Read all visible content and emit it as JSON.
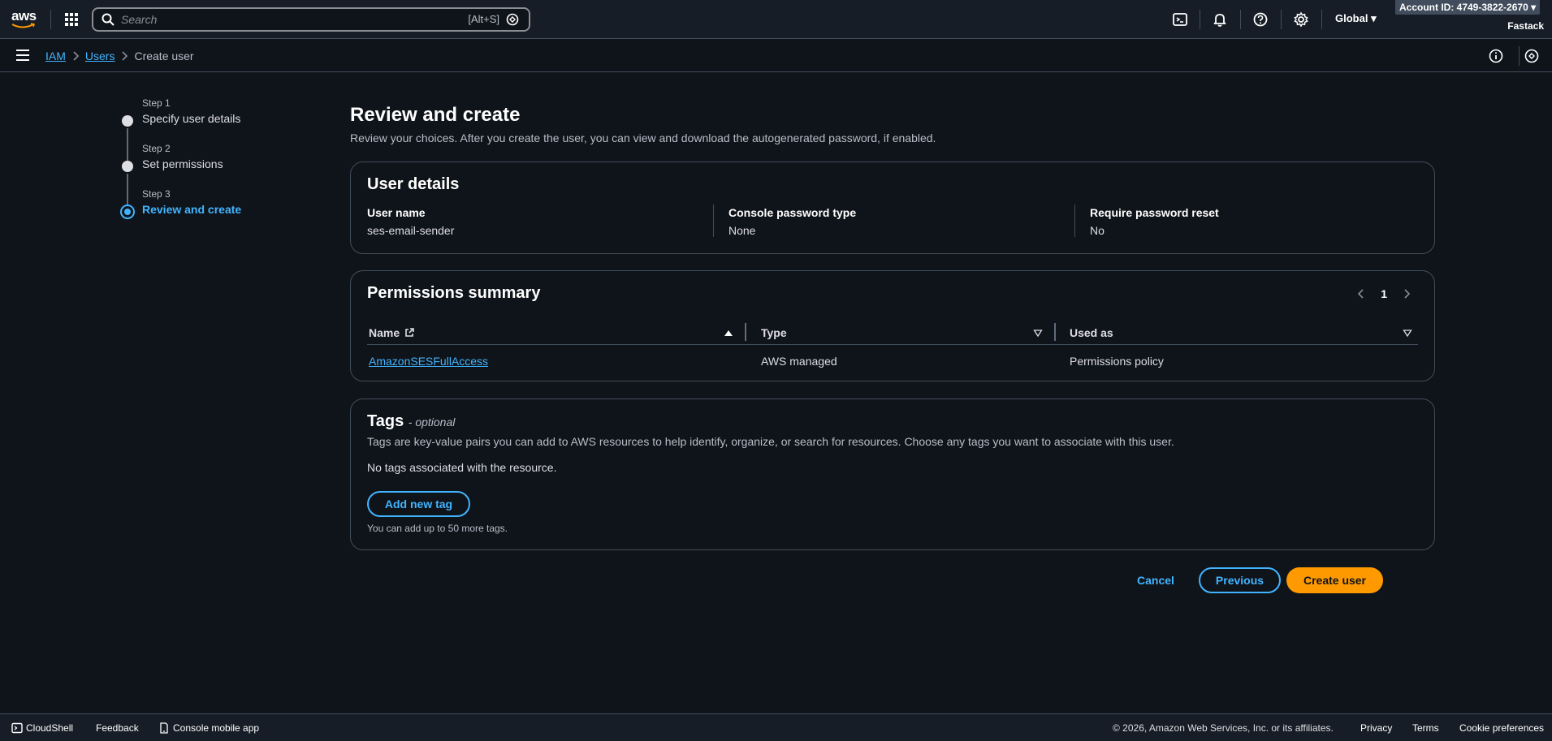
{
  "nav": {
    "logo": "aws",
    "search_placeholder": "Search",
    "search_shortcut": "[Alt+S]",
    "region": "Global",
    "account": "Account ID: 4749-3822-2670",
    "user": "Fastack",
    "icons": [
      "services-grid-icon",
      "cloudshell-icon",
      "bell-icon",
      "help-icon",
      "settings-icon"
    ]
  },
  "breadcrumb": {
    "items": [
      "IAM",
      "Users"
    ],
    "current": "Create user"
  },
  "stepper": {
    "steps": [
      {
        "label": "Step 1",
        "title": "Specify user details"
      },
      {
        "label": "Step 2",
        "title": "Set permissions"
      },
      {
        "label": "Step 3",
        "title": "Review and create"
      }
    ]
  },
  "page": {
    "title": "Review and create",
    "description": "Review your choices. After you create the user, you can view and download the autogenerated password, if enabled."
  },
  "user_details": {
    "title": "User details",
    "fields": [
      {
        "label": "User name",
        "value": "ses-email-sender"
      },
      {
        "label": "Console password type",
        "value": "None"
      },
      {
        "label": "Require password reset",
        "value": "No"
      }
    ]
  },
  "permissions": {
    "title": "Permissions summary",
    "page": "1",
    "columns": [
      "Name",
      "Type",
      "Used as"
    ],
    "rows": [
      {
        "name": "AmazonSESFullAccess",
        "type": "AWS managed",
        "used_as": "Permissions policy"
      }
    ]
  },
  "tags": {
    "title": "Tags",
    "optional": "- optional",
    "description": "Tags are key-value pairs you can add to AWS resources to help identify, organize, or search for resources. Choose any tags you want to associate with this user.",
    "empty": "No tags associated with the resource.",
    "add_button": "Add new tag",
    "hint": "You can add up to 50 more tags."
  },
  "actions": {
    "cancel": "Cancel",
    "previous": "Previous",
    "create": "Create user"
  },
  "footer": {
    "cloudshell": "CloudShell",
    "feedback": "Feedback",
    "mobile": "Console mobile app",
    "copyright": "© 2026, Amazon Web Services, Inc. or its affiliates.",
    "privacy": "Privacy",
    "terms": "Terms",
    "cookies": "Cookie preferences"
  },
  "colors": {
    "background": "#0f141a",
    "nav": "#161d26",
    "link": "#42b4ff",
    "primary": "#ff9900",
    "border": "#414d5c"
  }
}
